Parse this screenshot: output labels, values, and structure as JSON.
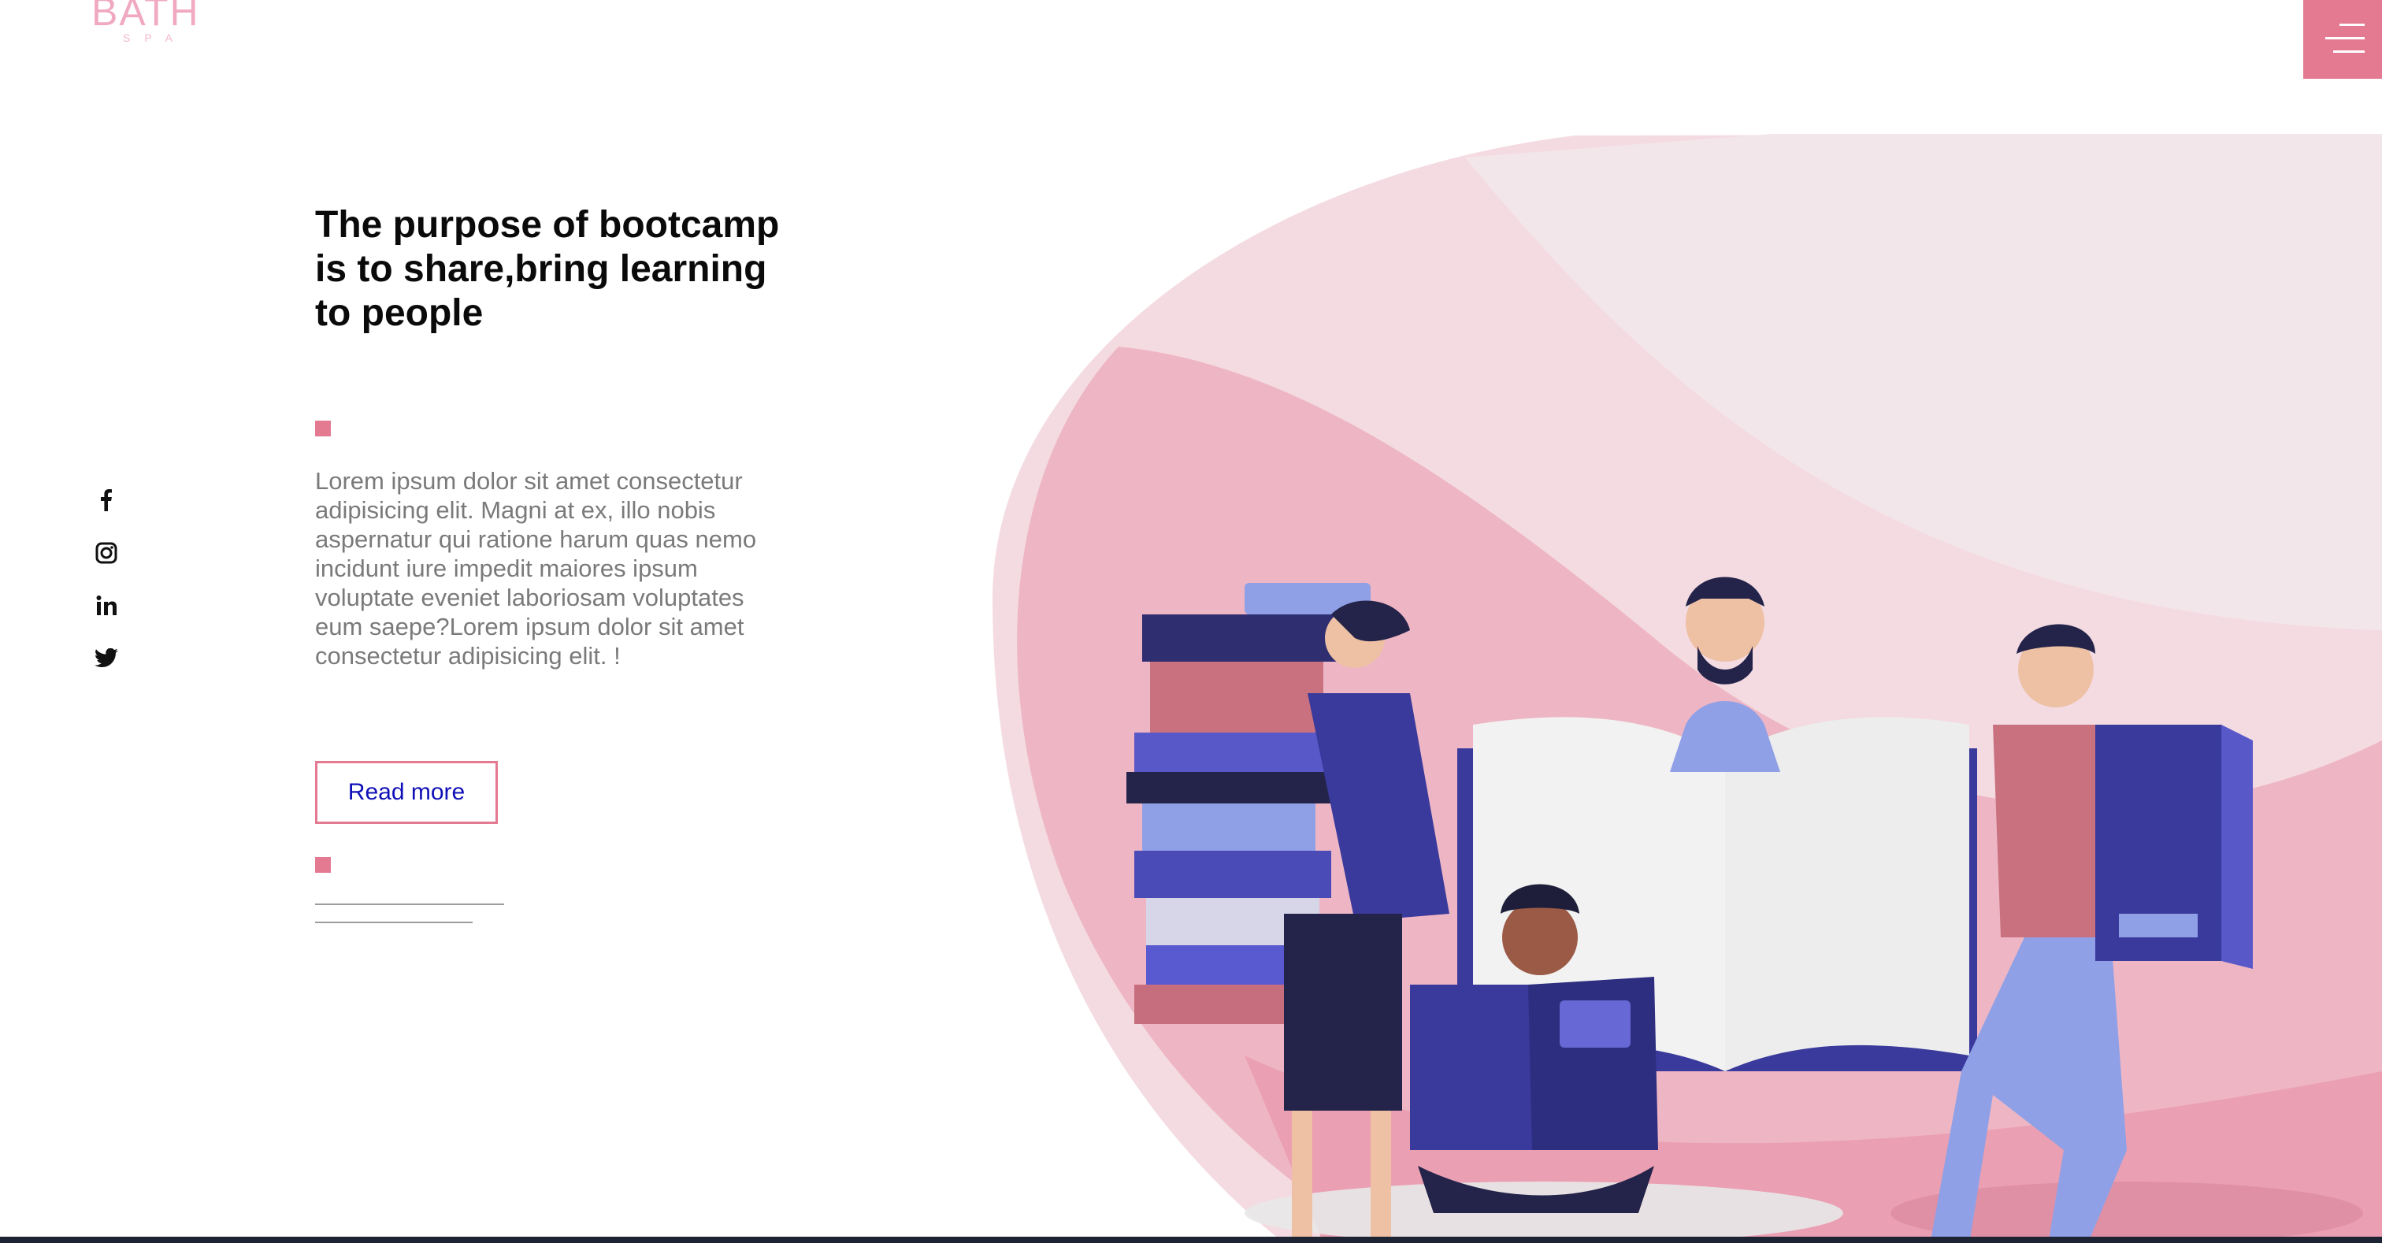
{
  "brand": {
    "logo_text": "BATH",
    "logo_sub": "SPA"
  },
  "hero": {
    "title": "The purpose of bootcamp is to share,bring learning to people",
    "body": "Lorem ipsum dolor sit amet consectetur adipisicing elit. Magni at ex, illo nobis aspernatur qui ratione harum quas nemo incidunt iure impedit maiores ipsum voluptate eveniet laboriosam voluptates eum saepe?Lorem ipsum dolor sit amet consectetur adipisicing elit. !",
    "cta_label": "Read more"
  },
  "social": [
    {
      "name": "facebook-icon",
      "glyph": "f"
    },
    {
      "name": "instagram-icon",
      "glyph": ""
    },
    {
      "name": "linkedin-icon",
      "glyph": "in"
    },
    {
      "name": "twitter-icon",
      "glyph": ""
    }
  ],
  "colors": {
    "accent": "#e37a92",
    "link": "#1010b8",
    "blob_light": "#f5d6de",
    "blob_mid": "#eeb8c6",
    "blob_dark": "#e998ac",
    "book_blue": "#3a3a8c"
  }
}
